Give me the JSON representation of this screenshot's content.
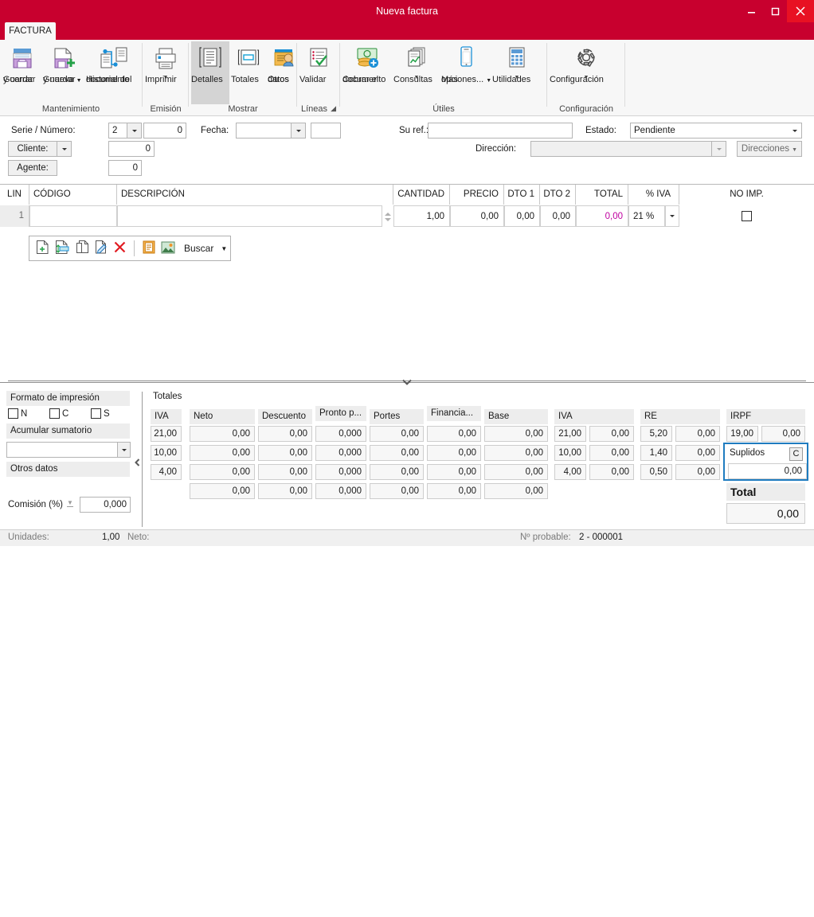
{
  "window": {
    "title": "Nueva factura",
    "accent_color": "#c8002e",
    "close_color": "#e81123",
    "controls": [
      {
        "name": "minimize",
        "glyph": "minimize-icon"
      },
      {
        "name": "maximize",
        "glyph": "maximize-icon"
      },
      {
        "name": "close",
        "glyph": "close-icon"
      }
    ]
  },
  "tab": {
    "label": "FACTURA"
  },
  "ribbon": {
    "groups": [
      {
        "label": "Mantenimiento",
        "buttons": [
          {
            "label1": "Guardar",
            "label2": "y cerrar",
            "icon": "save-close-icon",
            "caret": false
          },
          {
            "label1": "Guardar",
            "label2": "y nueva",
            "icon": "save-new-icon",
            "caret": true
          },
          {
            "label1": "Historial del",
            "label2": "documento",
            "icon": "document-history-icon",
            "caret": false
          }
        ]
      },
      {
        "label": "Emisión",
        "buttons": [
          {
            "label1": "Imprimir",
            "label2": "",
            "icon": "printer-icon",
            "caret": true
          }
        ]
      },
      {
        "label": "Mostrar",
        "buttons": [
          {
            "label1": "Detalles",
            "label2": "",
            "icon": "details-icon",
            "caret": false,
            "selected": true
          },
          {
            "label1": "Totales",
            "label2": "",
            "icon": "totals-icon",
            "caret": false
          },
          {
            "label1": "Otros",
            "label2": "datos",
            "icon": "other-data-icon",
            "caret": false
          }
        ]
      },
      {
        "label": "Líneas",
        "launcher": "dialog-launcher",
        "buttons": [
          {
            "label1": "Validar",
            "label2": "",
            "icon": "validate-icon",
            "caret": false
          }
        ]
      },
      {
        "label": "Útiles",
        "buttons": [
          {
            "label1": "Cobrar el",
            "label2": "documento",
            "icon": "money-collect-icon",
            "caret": false
          },
          {
            "label1": "Consultas",
            "label2": "",
            "icon": "queries-icon",
            "caret": true
          },
          {
            "label1": "Más",
            "label2": "opciones...",
            "icon": "more-options-icon",
            "caret": true
          },
          {
            "label1": "Utilidades",
            "label2": "",
            "icon": "utilities-icon",
            "caret": true
          }
        ]
      },
      {
        "label": "Configuración",
        "buttons": [
          {
            "label1": "Configuración",
            "label2": "",
            "icon": "gear-icon",
            "caret": true
          }
        ]
      }
    ]
  },
  "form": {
    "serie_label": "Serie / Número:",
    "serie_value": "2",
    "numero_value": "0",
    "fecha_label": "Fecha:",
    "fecha_value": "",
    "fecha_extra_value": "",
    "suref_label": "Su ref.:",
    "suref_value": "",
    "estado_label": "Estado:",
    "estado_value": "Pendiente",
    "cliente_label": "Cliente:",
    "cliente_value": "0",
    "direccion_label": "Dirección:",
    "direccion_value": "",
    "direcciones_button": "Direcciones",
    "agente_label": "Agente:",
    "agente_value": "0"
  },
  "grid": {
    "columns": [
      "LIN",
      "CÓDIGO",
      "DESCRIPCIÓN",
      "CANTIDAD",
      "PRECIO",
      "DTO 1",
      "DTO 2",
      "TOTAL",
      "% IVA",
      "NO IMP."
    ],
    "rows": [
      {
        "lin": "1",
        "codigo": "",
        "descripcion": "",
        "cantidad": "1,00",
        "precio": "0,00",
        "dto1": "0,00",
        "dto2": "0,00",
        "total": "0,00",
        "iva": "21 %",
        "no_imp": false
      }
    ],
    "total_color": "#c000a0"
  },
  "line_toolbar": {
    "icons": [
      "new-line-icon",
      "insert-line-icon",
      "copy-line-icon",
      "edit-line-icon",
      "delete-line-icon",
      "notes-icon",
      "image-icon"
    ],
    "search_label": "Buscar"
  },
  "left_panel": {
    "formato_title": "Formato de impresión",
    "formato_options": [
      {
        "label": "N",
        "checked": false
      },
      {
        "label": "C",
        "checked": false
      },
      {
        "label": "S",
        "checked": false
      }
    ],
    "acumular_title": "Acumular sumatorio",
    "acumular_value": "",
    "otros_title": "Otros datos",
    "comision_label": "Comisión (%)",
    "comision_value": "0,000"
  },
  "totales": {
    "title": "Totales",
    "headers_left": [
      "IVA",
      "Neto",
      "Descuento",
      "Pronto p...",
      "Portes",
      "Financia..."
    ],
    "headers_right": [
      "Base",
      "IVA",
      "RE",
      "IRPF"
    ],
    "rows": [
      {
        "iva_pct": "21,00",
        "neto": "0,00",
        "descuento": "0,00",
        "pronto": "0,000",
        "portes": "0,00",
        "financia": "0,00",
        "base": "0,00",
        "iva_r_pct": "21,00",
        "iva_r_val": "0,00",
        "re_pct": "5,20",
        "re_val": "0,00",
        "irpf_pct": "19,00",
        "irpf_val": "0,00"
      },
      {
        "iva_pct": "10,00",
        "neto": "0,00",
        "descuento": "0,00",
        "pronto": "0,000",
        "portes": "0,00",
        "financia": "0,00",
        "base": "0,00",
        "iva_r_pct": "10,00",
        "iva_r_val": "0,00",
        "re_pct": "1,40",
        "re_val": "0,00"
      },
      {
        "iva_pct": "4,00",
        "neto": "0,00",
        "descuento": "0,00",
        "pronto": "0,000",
        "portes": "0,00",
        "financia": "0,00",
        "base": "0,00",
        "iva_r_pct": "4,00",
        "iva_r_val": "0,00",
        "re_pct": "0,50",
        "re_val": "0,00"
      },
      {
        "iva_pct": "",
        "neto": "0,00",
        "descuento": "0,00",
        "pronto": "0,000",
        "portes": "0,00",
        "financia": "0,00",
        "base": "0,00"
      }
    ],
    "suplidos_label": "Suplidos",
    "suplidos_badge": "C",
    "suplidos_value": "0,00",
    "suplidos_border_color": "#1f7cc0",
    "total_label": "Total",
    "total_value": "0,00"
  },
  "status": {
    "unidades_label": "Unidades:",
    "unidades_value": "1,00",
    "neto_label": "Neto:",
    "neto_value": "",
    "probable_label": "Nº probable:",
    "probable_value": "2 - 000001"
  }
}
